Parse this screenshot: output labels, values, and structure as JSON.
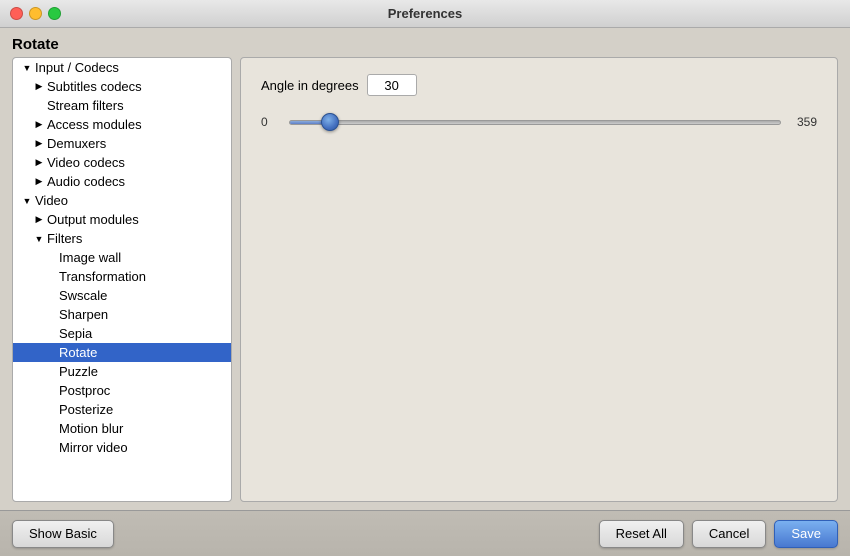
{
  "window": {
    "title": "Preferences"
  },
  "page": {
    "title": "Rotate"
  },
  "sidebar": {
    "items": [
      {
        "id": "input-codecs",
        "label": "Input / Codecs",
        "indent": "indent-1",
        "arrow": "down",
        "selected": false
      },
      {
        "id": "subtitles-codecs",
        "label": "Subtitles codecs",
        "indent": "indent-2",
        "arrow": "right",
        "selected": false
      },
      {
        "id": "stream-filters",
        "label": "Stream filters",
        "indent": "indent-2",
        "arrow": null,
        "selected": false
      },
      {
        "id": "access-modules",
        "label": "Access modules",
        "indent": "indent-2",
        "arrow": "right",
        "selected": false
      },
      {
        "id": "demuxers",
        "label": "Demuxers",
        "indent": "indent-2",
        "arrow": "right",
        "selected": false
      },
      {
        "id": "video-codecs",
        "label": "Video codecs",
        "indent": "indent-2",
        "arrow": "right",
        "selected": false
      },
      {
        "id": "audio-codecs",
        "label": "Audio codecs",
        "indent": "indent-2",
        "arrow": "right",
        "selected": false
      },
      {
        "id": "video",
        "label": "Video",
        "indent": "indent-1",
        "arrow": "down",
        "selected": false
      },
      {
        "id": "output-modules",
        "label": "Output modules",
        "indent": "indent-2",
        "arrow": "right",
        "selected": false
      },
      {
        "id": "filters",
        "label": "Filters",
        "indent": "indent-2",
        "arrow": "down",
        "selected": false
      },
      {
        "id": "image-wall",
        "label": "Image wall",
        "indent": "indent-3",
        "arrow": null,
        "selected": false
      },
      {
        "id": "transformation",
        "label": "Transformation",
        "indent": "indent-3",
        "arrow": null,
        "selected": false
      },
      {
        "id": "swscale",
        "label": "Swscale",
        "indent": "indent-3",
        "arrow": null,
        "selected": false
      },
      {
        "id": "sharpen",
        "label": "Sharpen",
        "indent": "indent-3",
        "arrow": null,
        "selected": false
      },
      {
        "id": "sepia",
        "label": "Sepia",
        "indent": "indent-3",
        "arrow": null,
        "selected": false
      },
      {
        "id": "rotate",
        "label": "Rotate",
        "indent": "indent-3",
        "arrow": null,
        "selected": true
      },
      {
        "id": "puzzle",
        "label": "Puzzle",
        "indent": "indent-3",
        "arrow": null,
        "selected": false
      },
      {
        "id": "postproc",
        "label": "Postproc",
        "indent": "indent-3",
        "arrow": null,
        "selected": false
      },
      {
        "id": "posterize",
        "label": "Posterize",
        "indent": "indent-3",
        "arrow": null,
        "selected": false
      },
      {
        "id": "motion-blur",
        "label": "Motion blur",
        "indent": "indent-3",
        "arrow": null,
        "selected": false
      },
      {
        "id": "mirror-video",
        "label": "Mirror video",
        "indent": "indent-3",
        "arrow": null,
        "selected": false
      }
    ]
  },
  "right_panel": {
    "angle_label": "Angle in degrees",
    "angle_value": "30",
    "slider_min": "0",
    "slider_max": "359",
    "slider_value": 30,
    "slider_percent": 8.4
  },
  "buttons": {
    "show_basic": "Show Basic",
    "reset_all": "Reset All",
    "cancel": "Cancel",
    "save": "Save"
  }
}
